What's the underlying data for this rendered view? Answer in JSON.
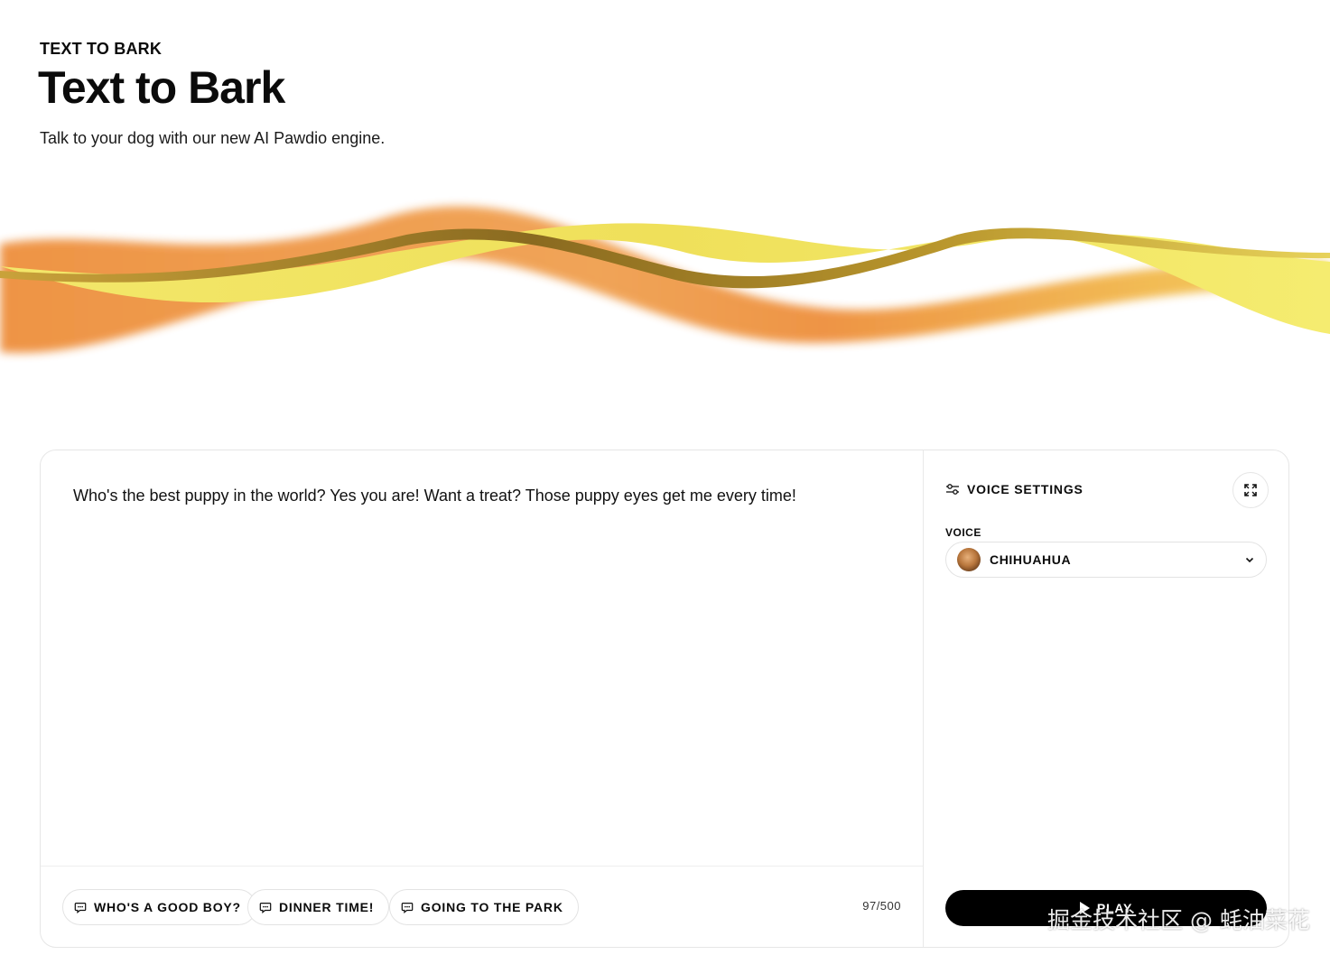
{
  "header": {
    "eyebrow": "TEXT TO BARK",
    "title": "Text to Bark",
    "subtitle": "Talk to your dog with our new AI Pawdio engine."
  },
  "editor": {
    "text": "Who's the best puppy in the world? Yes you are! Want a treat? Those puppy eyes get me every time!",
    "char_count": "97/500",
    "suggestions": [
      {
        "label": "WHO'S A GOOD BOY?",
        "icon": "chat-bubble-icon"
      },
      {
        "label": "DINNER TIME!",
        "icon": "chat-bubble-icon"
      },
      {
        "label": "GOING TO THE PARK",
        "icon": "chat-bubble-icon"
      }
    ]
  },
  "settings": {
    "title": "VOICE SETTINGS",
    "title_icon": "sliders-icon",
    "expand_icon": "expand-icon",
    "voice_label": "VOICE",
    "voice_value": "CHIHUAHUA",
    "play_label": "PLAY"
  },
  "colors": {
    "accent_yellow": "#f2e65a",
    "accent_orange": "#ee8f3c",
    "button_black": "#000000"
  },
  "watermark": "掘金技术社区 @ 蚝油菜花"
}
